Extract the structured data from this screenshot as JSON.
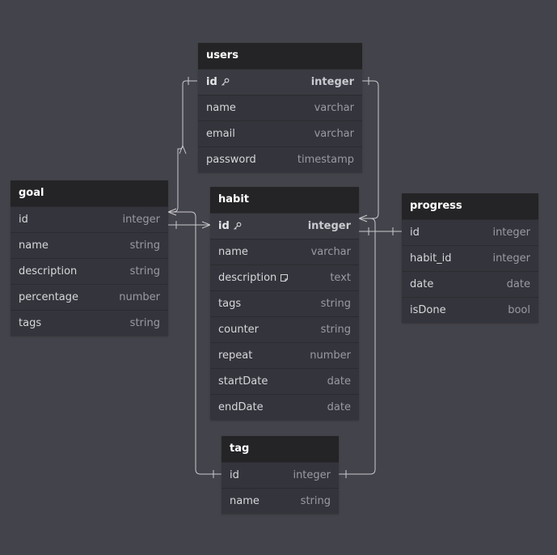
{
  "tables": {
    "users": {
      "title": "users",
      "fields": [
        {
          "name": "id",
          "type": "integer",
          "icon": "key-icon"
        },
        {
          "name": "name",
          "type": "varchar"
        },
        {
          "name": "email",
          "type": "varchar"
        },
        {
          "name": "password",
          "type": "timestamp"
        }
      ]
    },
    "goal": {
      "title": "goal",
      "fields": [
        {
          "name": "id",
          "type": "integer"
        },
        {
          "name": "name",
          "type": "string"
        },
        {
          "name": "description",
          "type": "string"
        },
        {
          "name": "percentage",
          "type": "number"
        },
        {
          "name": "tags",
          "type": "string"
        }
      ]
    },
    "habit": {
      "title": "habit",
      "fields": [
        {
          "name": "id",
          "type": "integer",
          "icon": "key-icon"
        },
        {
          "name": "name",
          "type": "varchar"
        },
        {
          "name": "description",
          "type": "text",
          "icon": "note-icon"
        },
        {
          "name": "tags",
          "type": "string"
        },
        {
          "name": "counter",
          "type": "string"
        },
        {
          "name": "repeat",
          "type": "number"
        },
        {
          "name": "startDate",
          "type": "date"
        },
        {
          "name": "endDate",
          "type": "date"
        }
      ]
    },
    "progress": {
      "title": "progress",
      "fields": [
        {
          "name": "id",
          "type": "integer"
        },
        {
          "name": "habit_id",
          "type": "integer"
        },
        {
          "name": "date",
          "type": "date"
        },
        {
          "name": "isDone",
          "type": "bool"
        }
      ]
    },
    "tag": {
      "title": "tag",
      "fields": [
        {
          "name": "id",
          "type": "integer"
        },
        {
          "name": "name",
          "type": "string"
        }
      ]
    }
  },
  "colors": {
    "canvas_background": "#43434b",
    "header_background": "#242426",
    "row_background": "#34343c",
    "connector": "#c8c8cc"
  }
}
